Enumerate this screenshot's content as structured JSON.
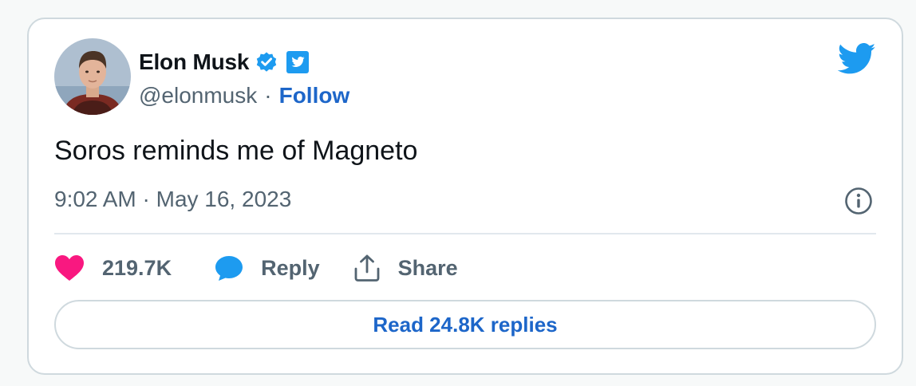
{
  "author": {
    "name": "Elon Musk",
    "handle": "@elonmusk",
    "separator": "·",
    "follow_label": "Follow",
    "avatar_icon": "profile-photo",
    "verified_icon": "verified-badge-icon",
    "platform_badge_icon": "twitter-badge-icon"
  },
  "tweet": {
    "text": "Soros reminds me of Magneto",
    "timestamp": "9:02 AM · May 16, 2023"
  },
  "actions": {
    "likes": "219.7K",
    "reply_label": "Reply",
    "share_label": "Share"
  },
  "read_replies_label": "Read 24.8K replies",
  "colors": {
    "accent": "#1d9bf0",
    "link": "#1d66c9",
    "like": "#f91880",
    "text": "#0f1419",
    "muted": "#536471",
    "border": "#cfd9de"
  }
}
